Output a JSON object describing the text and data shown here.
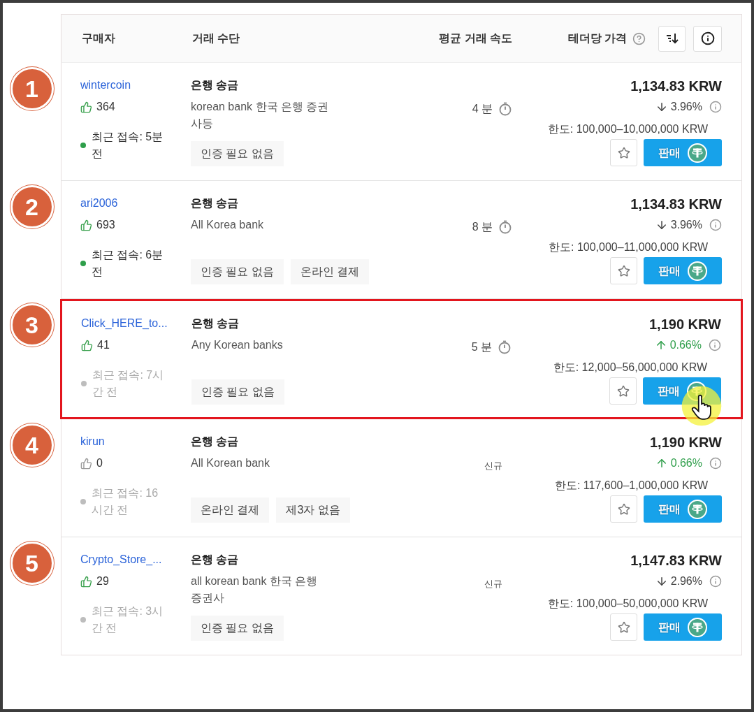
{
  "header": {
    "buyer": "구매자",
    "method": "거래 수단",
    "speed": "평균 거래 속도",
    "price": "테더당 가격"
  },
  "rows": [
    {
      "number": "1",
      "name": "wintercoin",
      "rating": "364",
      "rating_positive": true,
      "online": true,
      "last_seen": "최근 접속: 5분 전",
      "method": "은행 송금",
      "description": "korean bank 한국 은행 증권사등",
      "speed": {
        "kind": "time",
        "text": "4 분"
      },
      "tags": [
        "인증 필요 없음"
      ],
      "price": "1,134.83 KRW",
      "change": {
        "kind": "down",
        "text": "3.96%"
      },
      "limit": "한도: 100,000–10,000,000 KRW",
      "sell": "판매",
      "highlighted": false,
      "cursor": false
    },
    {
      "number": "2",
      "name": "ari2006",
      "rating": "693",
      "rating_positive": true,
      "online": true,
      "last_seen": "최근 접속: 6분 전",
      "method": "은행 송금",
      "description": "All Korea bank",
      "speed": {
        "kind": "time",
        "text": "8 분"
      },
      "tags": [
        "인증 필요 없음",
        "온라인 결제"
      ],
      "price": "1,134.83 KRW",
      "change": {
        "kind": "down",
        "text": "3.96%"
      },
      "limit": "한도: 100,000–11,000,000 KRW",
      "sell": "판매",
      "highlighted": false,
      "cursor": false
    },
    {
      "number": "3",
      "name": "Click_HERE_to...",
      "rating": "41",
      "rating_positive": true,
      "online": false,
      "last_seen": "최근 접속: 7시간 전",
      "method": "은행 송금",
      "description": "Any Korean banks",
      "speed": {
        "kind": "time",
        "text": "5 분"
      },
      "tags": [
        "인증 필요 없음"
      ],
      "price": "1,190 KRW",
      "change": {
        "kind": "up",
        "text": "0.66%"
      },
      "limit": "한도: 12,000–56,000,000 KRW",
      "sell": "판매",
      "highlighted": true,
      "cursor": true
    },
    {
      "number": "4",
      "name": "kirun",
      "rating": "0",
      "rating_positive": false,
      "online": false,
      "last_seen": "최근 접속: 16시간 전",
      "method": "은행 송금",
      "description": "All Korean bank",
      "speed": {
        "kind": "new",
        "text": "신규"
      },
      "tags": [
        "온라인 결제",
        "제3자 없음"
      ],
      "price": "1,190 KRW",
      "change": {
        "kind": "up",
        "text": "0.66%"
      },
      "limit": "한도: 117,600–1,000,000 KRW",
      "sell": "판매",
      "highlighted": false,
      "cursor": false
    },
    {
      "number": "5",
      "name": "Crypto_Store_...",
      "rating": "29",
      "rating_positive": true,
      "online": false,
      "last_seen": "최근 접속: 3시간 전",
      "method": "은행 송금",
      "description": "all korean bank 한국 은행 증권사",
      "speed": {
        "kind": "new",
        "text": "신규"
      },
      "tags": [
        "인증 필요 없음"
      ],
      "price": "1,147.83 KRW",
      "change": {
        "kind": "down",
        "text": "2.96%"
      },
      "limit": "한도: 100,000–50,000,000 KRW",
      "sell": "판매",
      "highlighted": false,
      "cursor": false
    }
  ]
}
